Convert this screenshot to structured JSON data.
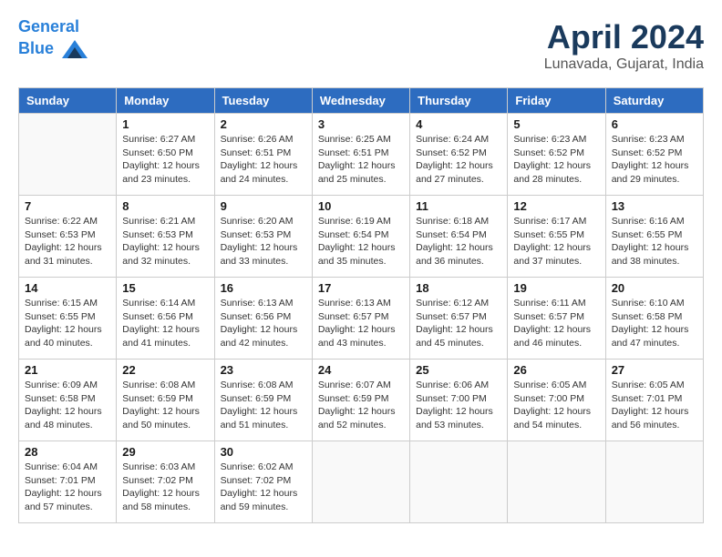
{
  "header": {
    "logo_line1": "General",
    "logo_line2": "Blue",
    "month_title": "April 2024",
    "location": "Lunavada, Gujarat, India"
  },
  "days_of_week": [
    "Sunday",
    "Monday",
    "Tuesday",
    "Wednesday",
    "Thursday",
    "Friday",
    "Saturday"
  ],
  "weeks": [
    [
      {
        "day": "",
        "info": ""
      },
      {
        "day": "1",
        "info": "Sunrise: 6:27 AM\nSunset: 6:50 PM\nDaylight: 12 hours\nand 23 minutes."
      },
      {
        "day": "2",
        "info": "Sunrise: 6:26 AM\nSunset: 6:51 PM\nDaylight: 12 hours\nand 24 minutes."
      },
      {
        "day": "3",
        "info": "Sunrise: 6:25 AM\nSunset: 6:51 PM\nDaylight: 12 hours\nand 25 minutes."
      },
      {
        "day": "4",
        "info": "Sunrise: 6:24 AM\nSunset: 6:52 PM\nDaylight: 12 hours\nand 27 minutes."
      },
      {
        "day": "5",
        "info": "Sunrise: 6:23 AM\nSunset: 6:52 PM\nDaylight: 12 hours\nand 28 minutes."
      },
      {
        "day": "6",
        "info": "Sunrise: 6:23 AM\nSunset: 6:52 PM\nDaylight: 12 hours\nand 29 minutes."
      }
    ],
    [
      {
        "day": "7",
        "info": "Sunrise: 6:22 AM\nSunset: 6:53 PM\nDaylight: 12 hours\nand 31 minutes."
      },
      {
        "day": "8",
        "info": "Sunrise: 6:21 AM\nSunset: 6:53 PM\nDaylight: 12 hours\nand 32 minutes."
      },
      {
        "day": "9",
        "info": "Sunrise: 6:20 AM\nSunset: 6:53 PM\nDaylight: 12 hours\nand 33 minutes."
      },
      {
        "day": "10",
        "info": "Sunrise: 6:19 AM\nSunset: 6:54 PM\nDaylight: 12 hours\nand 35 minutes."
      },
      {
        "day": "11",
        "info": "Sunrise: 6:18 AM\nSunset: 6:54 PM\nDaylight: 12 hours\nand 36 minutes."
      },
      {
        "day": "12",
        "info": "Sunrise: 6:17 AM\nSunset: 6:55 PM\nDaylight: 12 hours\nand 37 minutes."
      },
      {
        "day": "13",
        "info": "Sunrise: 6:16 AM\nSunset: 6:55 PM\nDaylight: 12 hours\nand 38 minutes."
      }
    ],
    [
      {
        "day": "14",
        "info": "Sunrise: 6:15 AM\nSunset: 6:55 PM\nDaylight: 12 hours\nand 40 minutes."
      },
      {
        "day": "15",
        "info": "Sunrise: 6:14 AM\nSunset: 6:56 PM\nDaylight: 12 hours\nand 41 minutes."
      },
      {
        "day": "16",
        "info": "Sunrise: 6:13 AM\nSunset: 6:56 PM\nDaylight: 12 hours\nand 42 minutes."
      },
      {
        "day": "17",
        "info": "Sunrise: 6:13 AM\nSunset: 6:57 PM\nDaylight: 12 hours\nand 43 minutes."
      },
      {
        "day": "18",
        "info": "Sunrise: 6:12 AM\nSunset: 6:57 PM\nDaylight: 12 hours\nand 45 minutes."
      },
      {
        "day": "19",
        "info": "Sunrise: 6:11 AM\nSunset: 6:57 PM\nDaylight: 12 hours\nand 46 minutes."
      },
      {
        "day": "20",
        "info": "Sunrise: 6:10 AM\nSunset: 6:58 PM\nDaylight: 12 hours\nand 47 minutes."
      }
    ],
    [
      {
        "day": "21",
        "info": "Sunrise: 6:09 AM\nSunset: 6:58 PM\nDaylight: 12 hours\nand 48 minutes."
      },
      {
        "day": "22",
        "info": "Sunrise: 6:08 AM\nSunset: 6:59 PM\nDaylight: 12 hours\nand 50 minutes."
      },
      {
        "day": "23",
        "info": "Sunrise: 6:08 AM\nSunset: 6:59 PM\nDaylight: 12 hours\nand 51 minutes."
      },
      {
        "day": "24",
        "info": "Sunrise: 6:07 AM\nSunset: 6:59 PM\nDaylight: 12 hours\nand 52 minutes."
      },
      {
        "day": "25",
        "info": "Sunrise: 6:06 AM\nSunset: 7:00 PM\nDaylight: 12 hours\nand 53 minutes."
      },
      {
        "day": "26",
        "info": "Sunrise: 6:05 AM\nSunset: 7:00 PM\nDaylight: 12 hours\nand 54 minutes."
      },
      {
        "day": "27",
        "info": "Sunrise: 6:05 AM\nSunset: 7:01 PM\nDaylight: 12 hours\nand 56 minutes."
      }
    ],
    [
      {
        "day": "28",
        "info": "Sunrise: 6:04 AM\nSunset: 7:01 PM\nDaylight: 12 hours\nand 57 minutes."
      },
      {
        "day": "29",
        "info": "Sunrise: 6:03 AM\nSunset: 7:02 PM\nDaylight: 12 hours\nand 58 minutes."
      },
      {
        "day": "30",
        "info": "Sunrise: 6:02 AM\nSunset: 7:02 PM\nDaylight: 12 hours\nand 59 minutes."
      },
      {
        "day": "",
        "info": ""
      },
      {
        "day": "",
        "info": ""
      },
      {
        "day": "",
        "info": ""
      },
      {
        "day": "",
        "info": ""
      }
    ]
  ]
}
